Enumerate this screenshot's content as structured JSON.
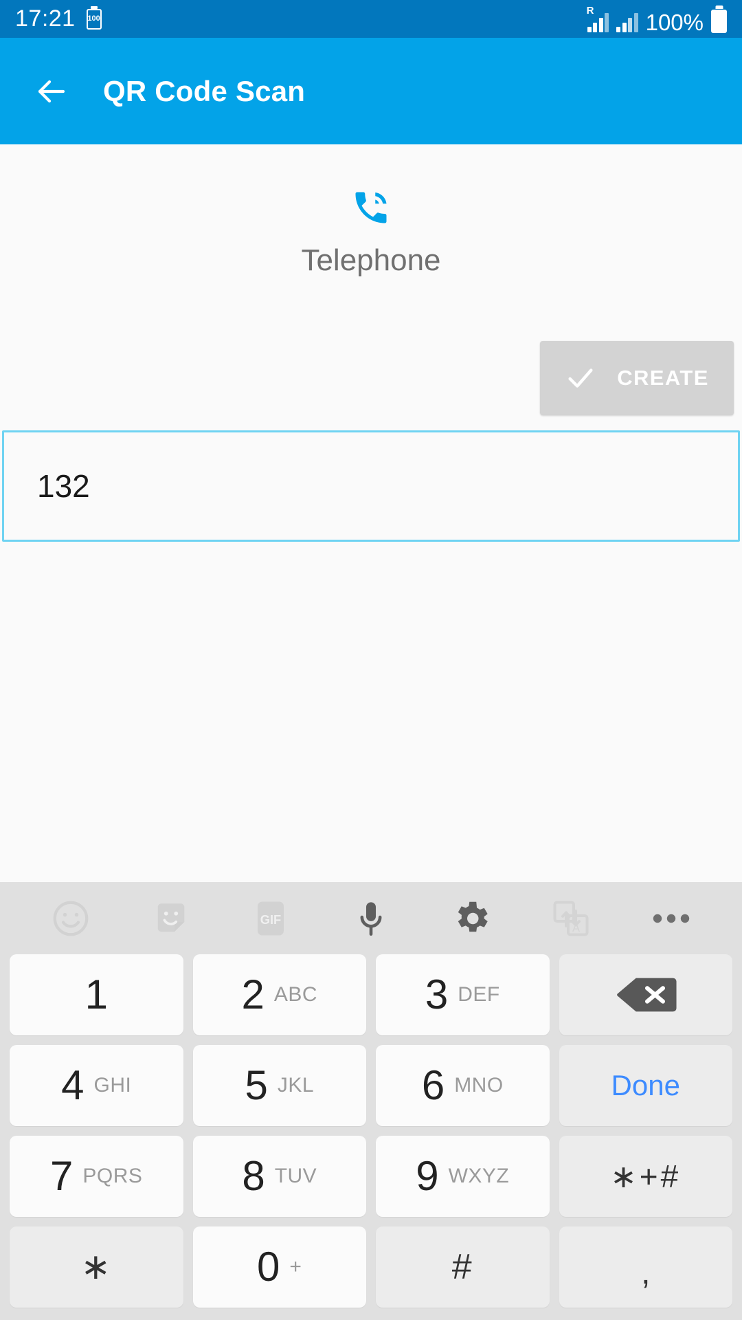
{
  "status_bar": {
    "clock": "17:21",
    "battery_saver_badge": "100",
    "roaming_label": "R",
    "battery_percent": "100%",
    "background_color": "#0277bd",
    "icons": [
      "battery-saver-icon",
      "roaming-signal-icon",
      "signal-icon",
      "battery-icon"
    ]
  },
  "app_bar": {
    "title": "QR Code Scan",
    "back_icon": "back-arrow-icon",
    "background_color": "#03a3e8"
  },
  "content": {
    "type_icon": "phone-in-talk-icon",
    "type_icon_color": "#03a3e8",
    "type_label": "Telephone",
    "create_button": {
      "label": "CREATE",
      "icon": "check-icon",
      "background_color": "#d3d3d3"
    },
    "input_field": {
      "value": "132",
      "placeholder": "",
      "border_color": "#6fd3f2"
    }
  },
  "keyboard": {
    "background_color": "#e0e0e0",
    "toolbar": [
      {
        "name": "emoji-icon",
        "enabled": false
      },
      {
        "name": "sticker-icon",
        "enabled": false
      },
      {
        "name": "gif-icon",
        "label": "GIF",
        "enabled": false
      },
      {
        "name": "microphone-icon",
        "enabled": true
      },
      {
        "name": "gear-icon",
        "enabled": true
      },
      {
        "name": "translate-icon",
        "enabled": false
      },
      {
        "name": "more-options-icon",
        "enabled": true
      }
    ],
    "rows": [
      [
        {
          "name": "key-1",
          "num": "1",
          "sub": "",
          "type": "num"
        },
        {
          "name": "key-2",
          "num": "2",
          "sub": "ABC",
          "type": "num"
        },
        {
          "name": "key-3",
          "num": "3",
          "sub": "DEF",
          "type": "num"
        },
        {
          "name": "key-backspace",
          "num": "",
          "sub": "",
          "type": "backspace"
        }
      ],
      [
        {
          "name": "key-4",
          "num": "4",
          "sub": "GHI",
          "type": "num"
        },
        {
          "name": "key-5",
          "num": "5",
          "sub": "JKL",
          "type": "num"
        },
        {
          "name": "key-6",
          "num": "6",
          "sub": "MNO",
          "type": "num"
        },
        {
          "name": "key-done",
          "num": "",
          "sub": "Done",
          "type": "done"
        }
      ],
      [
        {
          "name": "key-7",
          "num": "7",
          "sub": "PQRS",
          "type": "num"
        },
        {
          "name": "key-8",
          "num": "8",
          "sub": "TUV",
          "type": "num"
        },
        {
          "name": "key-9",
          "num": "9",
          "sub": "WXYZ",
          "type": "num"
        },
        {
          "name": "key-symbols",
          "num": "",
          "sub": "∗+#",
          "type": "sym-small"
        }
      ],
      [
        {
          "name": "key-asterisk",
          "num": "",
          "sub": "∗",
          "type": "sym"
        },
        {
          "name": "key-0",
          "num": "0",
          "sub": "+",
          "type": "num-plus"
        },
        {
          "name": "key-hash",
          "num": "",
          "sub": "#",
          "type": "sym"
        },
        {
          "name": "key-comma",
          "num": "",
          "sub": ",",
          "type": "comma"
        }
      ]
    ]
  }
}
